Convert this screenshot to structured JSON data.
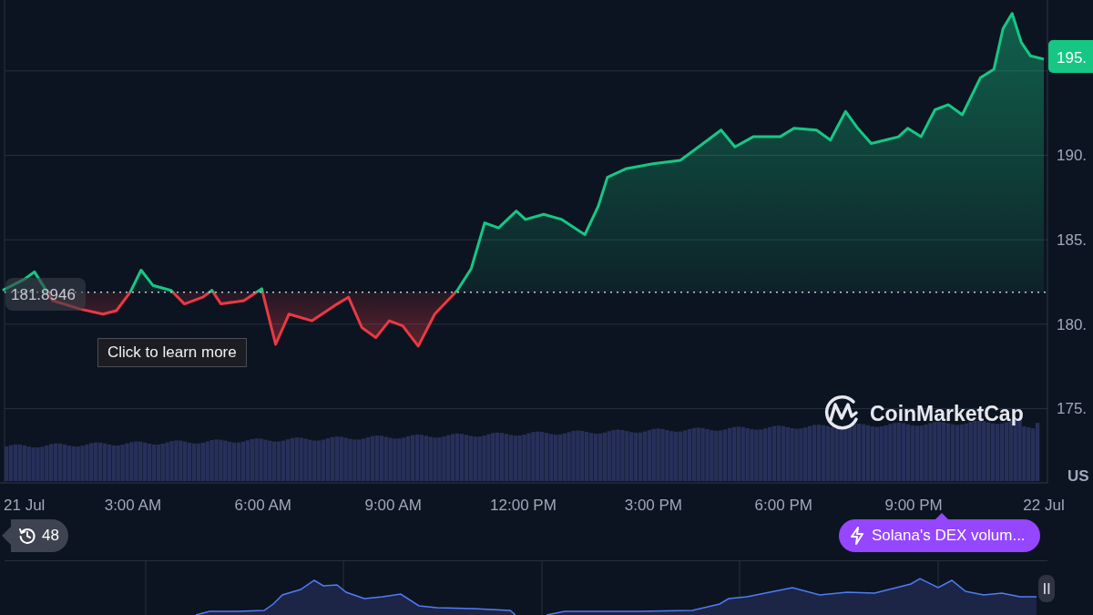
{
  "chart": {
    "chart_data": {
      "type": "area",
      "xlim": [
        0,
        24
      ],
      "ylim": [
        170.6,
        199.2
      ],
      "x": [
        0,
        0.52,
        0.73,
        1.15,
        1.78,
        2.31,
        2.62,
        2.94,
        3.19,
        3.46,
        3.88,
        4.19,
        4.61,
        4.82,
        5.03,
        5.56,
        5.97,
        6.29,
        6.6,
        7.13,
        7.65,
        7.97,
        8.28,
        8.6,
        8.91,
        9.22,
        9.58,
        9.96,
        10.48,
        10.8,
        11.11,
        11.43,
        11.84,
        12.05,
        12.47,
        12.89,
        13.42,
        13.73,
        13.94,
        14.36,
        14.99,
        15.62,
        16.04,
        16.56,
        16.88,
        17.3,
        17.92,
        18.24,
        18.76,
        19.08,
        19.43,
        19.71,
        20.02,
        20.65,
        20.86,
        21.17,
        21.49,
        21.8,
        22.12,
        22.54,
        22.85,
        23.06,
        23.27,
        23.48,
        23.69,
        24
      ],
      "grid": true,
      "series": [
        {
          "color": "#16c784",
          "values": [
            182.0,
            182.7,
            183.1,
            181.4,
            180.9,
            180.6,
            180.8,
            181.9,
            183.2,
            182.3,
            182.0,
            181.2,
            181.6,
            182.0,
            181.2,
            181.4,
            182.1,
            178.8,
            180.6,
            180.2,
            181.1,
            181.6,
            179.8,
            179.2,
            180.2,
            179.9,
            178.7,
            180.6,
            182.0,
            183.3,
            186.0,
            185.7,
            186.7,
            186.2,
            186.5,
            186.2,
            185.3,
            187.0,
            188.7,
            189.2,
            189.5,
            189.7,
            190.5,
            191.5,
            190.5,
            191.1,
            191.1,
            191.6,
            191.5,
            190.9,
            192.6,
            191.6,
            190.7,
            191.1,
            191.6,
            191.1,
            192.7,
            193.0,
            192.4,
            194.6,
            195.1,
            197.5,
            198.4,
            196.7,
            195.9,
            195.7
          ]
        }
      ],
      "xticks": [
        {
          "value": 0,
          "label": "21 Jul"
        },
        {
          "value": 3,
          "label": "3:00 AM"
        },
        {
          "value": 6,
          "label": "6:00 AM"
        },
        {
          "value": 9,
          "label": "9:00 AM"
        },
        {
          "value": 12,
          "label": "12:00 PM"
        },
        {
          "value": 15,
          "label": "3:00 PM"
        },
        {
          "value": 18,
          "label": "6:00 PM"
        },
        {
          "value": 21,
          "label": "9:00 PM"
        },
        {
          "value": 24,
          "label": "22 Jul"
        }
      ],
      "yticks": [
        {
          "value": 175,
          "label": "175."
        },
        {
          "value": 180,
          "label": "180."
        },
        {
          "value": 185,
          "label": "185."
        },
        {
          "value": 190,
          "label": "190."
        }
      ]
    },
    "baseline_label": "181.8946",
    "last_price_label": "195.",
    "unit_label": "US",
    "watermark": "CoinMarketCap",
    "tooltip": "Click to learn more"
  },
  "history_badge": {
    "count": "48"
  },
  "event_pill": {
    "text": "Solana's DEX volum..."
  }
}
